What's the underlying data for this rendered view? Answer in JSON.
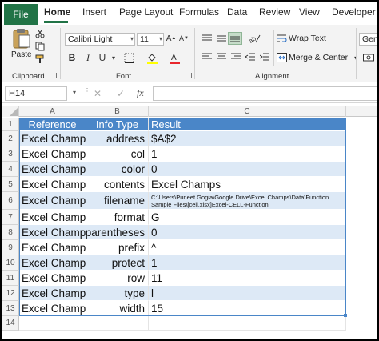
{
  "ribbon_tabs": [
    "File",
    "Home",
    "Insert",
    "Page Layout",
    "Formulas",
    "Data",
    "Review",
    "View",
    "Developer"
  ],
  "clipboard": {
    "paste_label": "Paste",
    "group_label": "Clipboard"
  },
  "font": {
    "name": "Calibri Light",
    "size": "11",
    "group_label": "Font",
    "bold": "B",
    "italic": "I",
    "underline": "U"
  },
  "alignment": {
    "wrap_text": "Wrap Text",
    "merge_center": "Merge & Center",
    "group_label": "Alignment"
  },
  "number": {
    "format_partial": "Gene"
  },
  "formula_bar": {
    "name_box": "H14",
    "fx": "fx",
    "cancel": "✕",
    "enter": "✓"
  },
  "columns": [
    "A",
    "B",
    "C"
  ],
  "rows": [
    "1",
    "2",
    "3",
    "4",
    "5",
    "6",
    "7",
    "8",
    "9",
    "10",
    "11",
    "12",
    "13",
    "14"
  ],
  "table": {
    "headers": [
      "Reference",
      "Info Type",
      "Result"
    ],
    "data": [
      [
        "Excel Champs",
        "address",
        "$A$2"
      ],
      [
        "Excel Champs",
        "col",
        "1"
      ],
      [
        "Excel Champs",
        "color",
        "0"
      ],
      [
        "Excel Champs",
        "contents",
        "Excel Champs"
      ],
      [
        "Excel Champs",
        "filename",
        "C:\\Users\\Puneet Gogia\\Google Drive\\Excel Champs\\Data\\Function Sample Files\\[cell.xlsx]Excel-CELL-Function"
      ],
      [
        "Excel Champs",
        "format",
        "G"
      ],
      [
        "Excel Champs",
        "parentheses",
        "0"
      ],
      [
        "Excel Champs",
        "prefix",
        "^"
      ],
      [
        "Excel Champs",
        "protect",
        "1"
      ],
      [
        "Excel Champs",
        "row",
        "11"
      ],
      [
        "Excel Champs",
        "type",
        "l"
      ],
      [
        "Excel Champs",
        "width",
        "15"
      ]
    ]
  },
  "colors": {
    "accent": "#217346",
    "table_header": "#4a86c8",
    "band": "#dde9f6"
  }
}
